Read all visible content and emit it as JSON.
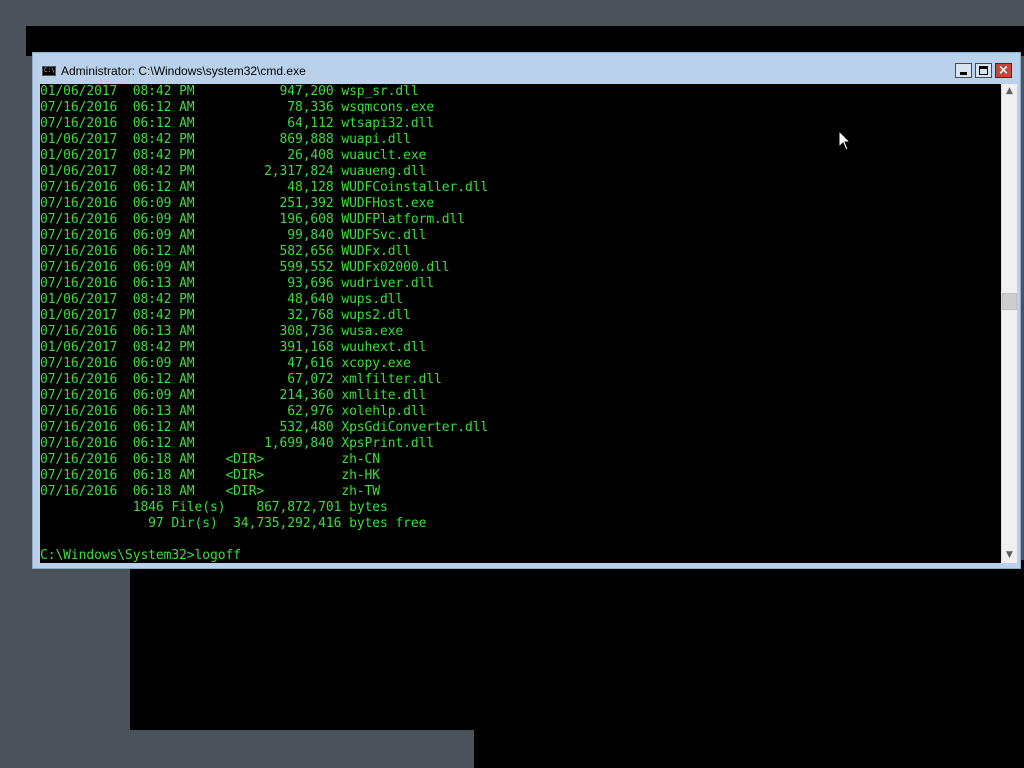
{
  "window": {
    "title": "Administrator: C:\\Windows\\system32\\cmd.exe",
    "icon_text": "C:\\",
    "controls": {
      "minimize": "minimize-icon",
      "maximize": "maximize-icon",
      "close": "×"
    }
  },
  "console": {
    "text_color": "#3ddc3d",
    "lines": [
      "01/06/2017  08:42 PM           947,200 wsp_sr.dll",
      "07/16/2016  06:12 AM            78,336 wsqmcons.exe",
      "07/16/2016  06:12 AM            64,112 wtsapi32.dll",
      "01/06/2017  08:42 PM           869,888 wuapi.dll",
      "01/06/2017  08:42 PM            26,408 wuauclt.exe",
      "01/06/2017  08:42 PM         2,317,824 wuaueng.dll",
      "07/16/2016  06:12 AM            48,128 WUDFCoinstaller.dll",
      "07/16/2016  06:09 AM           251,392 WUDFHost.exe",
      "07/16/2016  06:09 AM           196,608 WUDFPlatform.dll",
      "07/16/2016  06:09 AM            99,840 WUDFSvc.dll",
      "07/16/2016  06:12 AM           582,656 WUDFx.dll",
      "07/16/2016  06:09 AM           599,552 WUDFx02000.dll",
      "07/16/2016  06:13 AM            93,696 wudriver.dll",
      "01/06/2017  08:42 PM            48,640 wups.dll",
      "01/06/2017  08:42 PM            32,768 wups2.dll",
      "07/16/2016  06:13 AM           308,736 wusa.exe",
      "01/06/2017  08:42 PM           391,168 wuuhext.dll",
      "07/16/2016  06:09 AM            47,616 xcopy.exe",
      "07/16/2016  06:12 AM            67,072 xmlfilter.dll",
      "07/16/2016  06:09 AM           214,360 xmllite.dll",
      "07/16/2016  06:13 AM            62,976 xolehlp.dll",
      "07/16/2016  06:12 AM           532,480 XpsGdiConverter.dll",
      "07/16/2016  06:12 AM         1,699,840 XpsPrint.dll",
      "07/16/2016  06:18 AM    <DIR>          zh-CN",
      "07/16/2016  06:18 AM    <DIR>          zh-HK",
      "07/16/2016  06:18 AM    <DIR>          zh-TW",
      "            1846 File(s)    867,872,701 bytes",
      "              97 Dir(s)  34,735,292,416 bytes free",
      "",
      "C:\\Windows\\System32>logoff"
    ]
  },
  "scrollbar": {
    "up_arrow": "▲",
    "down_arrow": "▼",
    "position_fraction": 0.45
  },
  "pointer": "mouse-pointer-icon"
}
